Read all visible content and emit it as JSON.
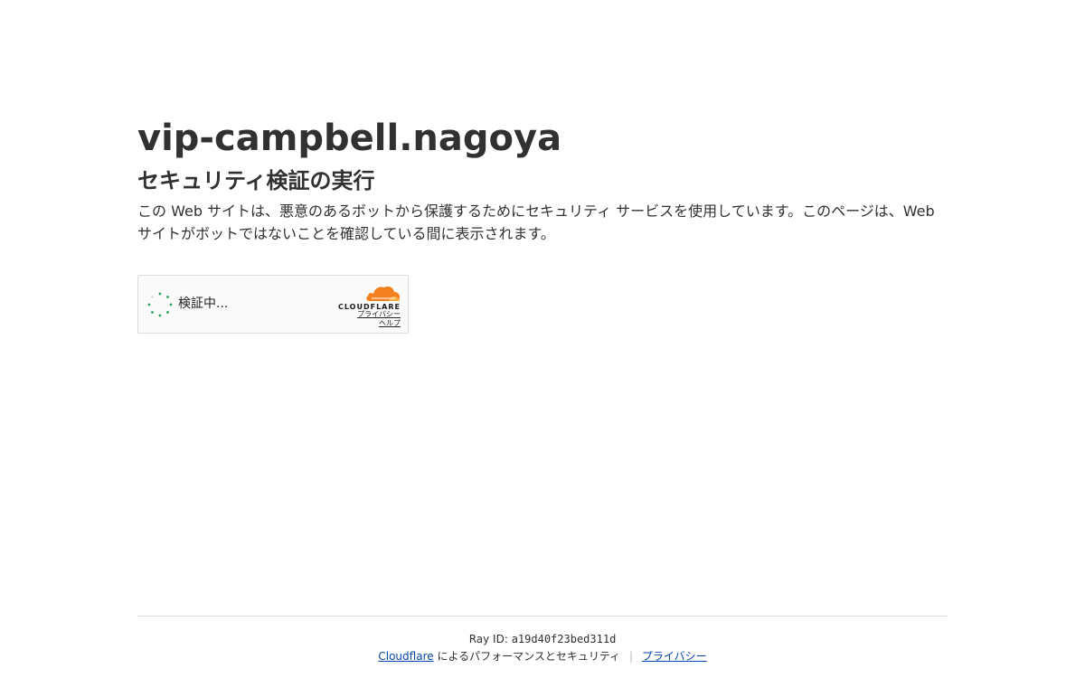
{
  "header": {
    "site_title": "vip-campbell.nagoya",
    "subtitle": "セキュリティ検証の実行",
    "description": "この Web サイトは、悪意のあるボットから保護するためにセキュリティ サービスを使用しています。このページは、Web サイトがボットではないことを確認している間に表示されます。"
  },
  "widget": {
    "status_text": "検証中...",
    "brand_wordmark": "CLOUDFLARE",
    "privacy_link": "プライバシー",
    "help_link": "ヘルプ",
    "spinner_color": "#2d9f5e",
    "brand_color": "#f48120"
  },
  "footer": {
    "ray_label": "Ray ID:",
    "ray_id": "a19d40f23bed311d",
    "cloudflare_link": "Cloudflare",
    "performance_text": "によるパフォーマンスとセキュリティ",
    "separator": "|",
    "privacy_link": "プライバシー"
  }
}
